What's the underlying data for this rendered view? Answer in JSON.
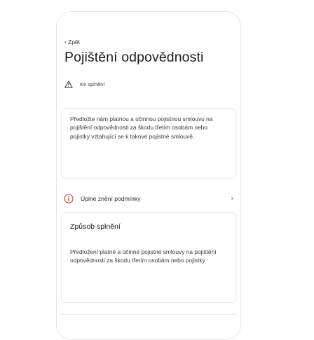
{
  "nav": {
    "back_label": "Zpět"
  },
  "page": {
    "title": "Pojištění odpovědnosti"
  },
  "status": {
    "label": "Ke splnění",
    "icon": "warning-triangle-icon"
  },
  "requirement_card": {
    "text": "Předložte nám platnou a účinnou pojistnou smlouvu na pojištění odpovědnosti za škodu třetím osobám nebo pojistky vztahující se k takové pojistné smlouvě."
  },
  "terms_link": {
    "label": "Úplné znění podmínky",
    "icon": "info-circle-icon",
    "accent_color": "#e0352b"
  },
  "fulfillment_card": {
    "heading": "Způsob splnění",
    "text": "Předložení platné a účinné pojistné smlouvy na pojištění odpovědnosti za škodu třetím osobám nebo pojistky"
  }
}
